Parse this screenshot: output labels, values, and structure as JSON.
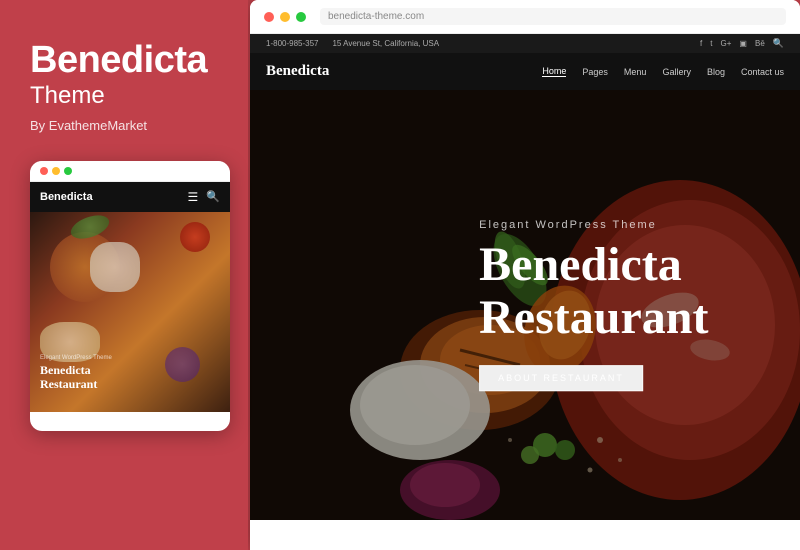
{
  "left": {
    "title": "Benedicta",
    "subtitle": "Theme",
    "author": "By EvathemeMarket"
  },
  "mobile": {
    "logo": "Benedicta",
    "hero_small": "Elegant WordPress Theme",
    "hero_title": "Benedicta\nRestaurant"
  },
  "desktop": {
    "address": "15 Avenue St, California, USA",
    "phone": "1-800-985-357",
    "logo": "Benedicta",
    "menu_items": [
      "Home",
      "Pages",
      "Menu",
      "Gallery",
      "Blog",
      "Contact us"
    ],
    "active_menu": "Home",
    "hero_eyebrow": "Elegant WordPress Theme",
    "hero_title_line1": "Benedicta",
    "hero_title_line2": "Restaurant",
    "cta_button": "ABOUT RESTAURANT"
  },
  "dots": {
    "red": "#ff5f56",
    "yellow": "#ffbd2e",
    "green": "#27c93f"
  }
}
